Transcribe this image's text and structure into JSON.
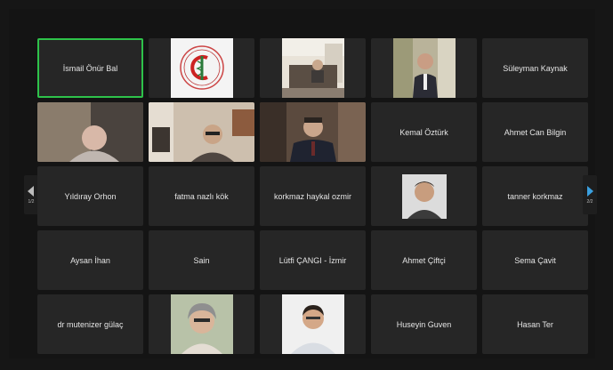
{
  "participants": [
    {
      "name": "İsmail Önür Bal",
      "active": true
    },
    {
      "name": "",
      "kind": "logo"
    },
    {
      "name": "",
      "kind": "video-room"
    },
    {
      "name": "",
      "kind": "video-man-suit"
    },
    {
      "name": "Süleyman Kaynak"
    },
    {
      "name": "",
      "kind": "video-bald-man"
    },
    {
      "name": "",
      "kind": "video-woman-glasses"
    },
    {
      "name": "",
      "kind": "video-man-tie"
    },
    {
      "name": "Kemal Öztürk"
    },
    {
      "name": "Ahmet Can Bilgin"
    },
    {
      "name": "Yıldıray Orhon"
    },
    {
      "name": "fatma nazlı kök"
    },
    {
      "name": "korkmaz haykal ozmir"
    },
    {
      "name": "",
      "kind": "photo-man"
    },
    {
      "name": "tanner korkmaz"
    },
    {
      "name": "Aysan İhan"
    },
    {
      "name": "Sain"
    },
    {
      "name": "Lütfi ÇANGI - İzmir"
    },
    {
      "name": "Ahmet Çiftçi"
    },
    {
      "name": "Sema Çavit"
    },
    {
      "name": "dr mutenizer gülaç"
    },
    {
      "name": "",
      "kind": "photo-woman-curly"
    },
    {
      "name": "",
      "kind": "photo-young-man"
    },
    {
      "name": "Huseyin Guven"
    },
    {
      "name": "Hasan Ter"
    }
  ],
  "pagination": {
    "prev_icon": "chevron-left-icon",
    "next_icon": "chevron-right-icon",
    "prev_page": "1/2",
    "next_page": "2/2"
  },
  "colors": {
    "background": "#161616",
    "tile": "#262626",
    "active_speaker": "#2ec24a",
    "next_arrow": "#3aa0e0"
  }
}
